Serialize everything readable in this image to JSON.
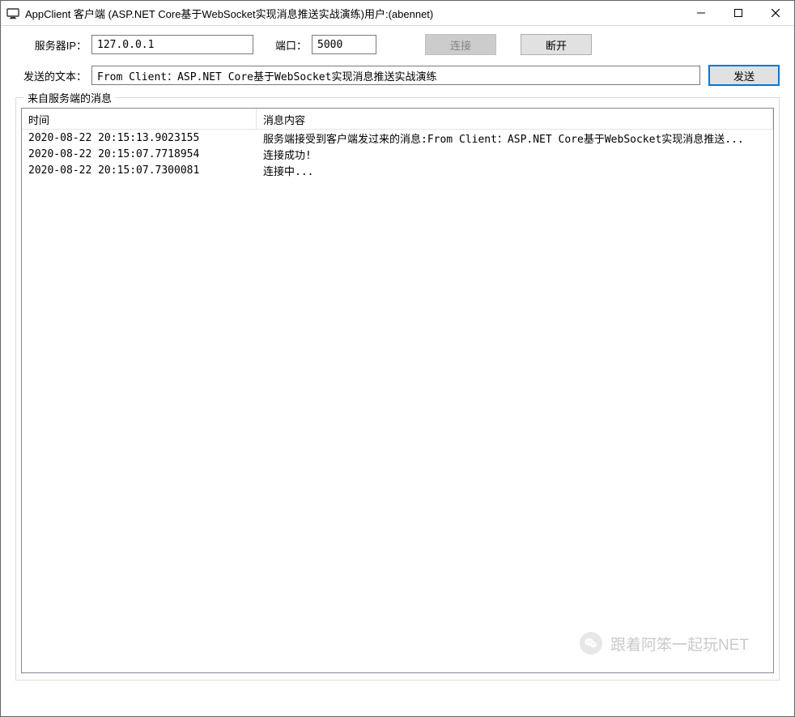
{
  "window": {
    "title": "AppClient 客户端 (ASP.NET Core基于WebSocket实现消息推送实战演练)用户:(abennet)"
  },
  "form": {
    "server_ip_label": "服务器IP：",
    "server_ip_value": "127.0.0.1",
    "port_label": "端口：",
    "port_value": "5000",
    "connect_button": "连接",
    "disconnect_button": "断开",
    "send_text_label": "发送的文本：",
    "send_text_value": "From Client：ASP.NET Core基于WebSocket实现消息推送实战演练",
    "send_button": "发送"
  },
  "groupbox": {
    "legend": "来自服务端的消息",
    "columns": {
      "time": "时间",
      "message": "消息内容"
    },
    "rows": [
      {
        "time": "2020-08-22 20:15:13.9023155",
        "message": "服务端接受到客户端发过来的消息:From Client：ASP.NET Core基于WebSocket实现消息推送..."
      },
      {
        "time": "2020-08-22 20:15:07.7718954",
        "message": "连接成功!"
      },
      {
        "time": "2020-08-22 20:15:07.7300081",
        "message": "连接中..."
      }
    ]
  },
  "watermark": {
    "text": "跟着阿笨一起玩NET"
  }
}
